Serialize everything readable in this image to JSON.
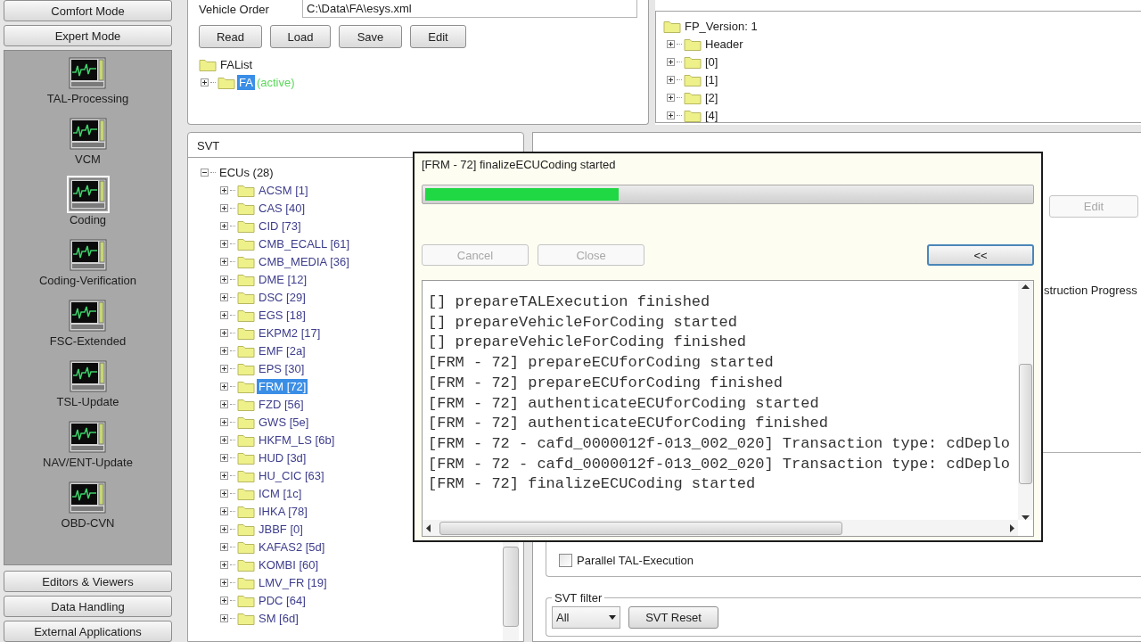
{
  "sidebar": {
    "top_buttons": [
      "Comfort Mode",
      "Expert Mode"
    ],
    "tools": [
      {
        "label": "TAL-Processing",
        "selected": false
      },
      {
        "label": "VCM",
        "selected": false
      },
      {
        "label": "Coding",
        "selected": true
      },
      {
        "label": "Coding-Verification",
        "selected": false
      },
      {
        "label": "FSC-Extended",
        "selected": false
      },
      {
        "label": "TSL-Update",
        "selected": false
      },
      {
        "label": "NAV/ENT-Update",
        "selected": false
      },
      {
        "label": "OBD-CVN",
        "selected": false
      }
    ],
    "bottom_buttons": [
      "Editors & Viewers",
      "Data Handling",
      "External Applications"
    ]
  },
  "vehicle_order": {
    "label": "Vehicle Order",
    "path": "C:\\Data\\FA\\esys.xml",
    "buttons": [
      "Read",
      "Load",
      "Save",
      "Edit"
    ],
    "tree": {
      "label": "FAList",
      "children": [
        {
          "label": "FA",
          "status": "(active)",
          "selected": true
        }
      ]
    }
  },
  "vehicle_profile": {
    "tree": {
      "label": "FP_Version: 1",
      "children": [
        {
          "label": "Header"
        },
        {
          "label": "[0]"
        },
        {
          "label": "[1]"
        },
        {
          "label": "[2]"
        },
        {
          "label": "[4]"
        }
      ]
    }
  },
  "svt": {
    "title": "SVT",
    "tree": {
      "label": "ECUs (28)",
      "expanded": true,
      "children": [
        {
          "label": "ACSM [1]",
          "selected": false
        },
        {
          "label": "CAS [40]",
          "selected": false
        },
        {
          "label": "CID [73]",
          "selected": false
        },
        {
          "label": "CMB_ECALL [61]",
          "selected": false
        },
        {
          "label": "CMB_MEDIA [36]",
          "selected": false
        },
        {
          "label": "DME [12]",
          "selected": false
        },
        {
          "label": "DSC [29]",
          "selected": false
        },
        {
          "label": "EGS [18]",
          "selected": false
        },
        {
          "label": "EKPM2 [17]",
          "selected": false
        },
        {
          "label": "EMF [2a]",
          "selected": false
        },
        {
          "label": "EPS [30]",
          "selected": false
        },
        {
          "label": "FRM [72]",
          "selected": true
        },
        {
          "label": "FZD [56]",
          "selected": false
        },
        {
          "label": "GWS [5e]",
          "selected": false
        },
        {
          "label": "HKFM_LS [6b]",
          "selected": false
        },
        {
          "label": "HUD [3d]",
          "selected": false
        },
        {
          "label": "HU_CIC [63]",
          "selected": false
        },
        {
          "label": "ICM [1c]",
          "selected": false
        },
        {
          "label": "IHKA [78]",
          "selected": false
        },
        {
          "label": "JBBF [0]",
          "selected": false
        },
        {
          "label": "KAFAS2 [5d]",
          "selected": false
        },
        {
          "label": "KOMBI [60]",
          "selected": false
        },
        {
          "label": "LMV_FR [19]",
          "selected": false
        },
        {
          "label": "PDC [64]",
          "selected": false
        },
        {
          "label": "SM [6d]",
          "selected": false
        }
      ]
    }
  },
  "svt_actual": {
    "edit_button": {
      "label": "Edit",
      "disabled": true
    },
    "progress_label": "struction Progress",
    "parallel": {
      "label": "Parallel TAL-Execution",
      "checked": false
    },
    "filter": {
      "title": "SVT filter",
      "value": "All",
      "reset": "SVT Reset"
    }
  },
  "dialog": {
    "status": "[FRM - 72] finalizeECUCoding started",
    "level": 0.32,
    "buttons": [
      {
        "label": "Cancel",
        "disabled": true
      },
      {
        "label": "Close",
        "disabled": true
      }
    ],
    "toggle": "<<",
    "log": [
      "[] prepareTALExecution finished",
      "[] prepareVehicleForCoding started",
      "[] prepareVehicleForCoding finished",
      "[FRM - 72] prepareECUforCoding started",
      "[FRM - 72] prepareECUforCoding finished",
      "[FRM - 72] authenticateECUforCoding started",
      "[FRM - 72] authenticateECUforCoding finished",
      "[FRM - 72 - cafd_0000012f-013_002_020] Transaction type: cdDeplo",
      "[FRM - 72 - cafd_0000012f-013_002_020] Transaction type: cdDeplo",
      "[FRM - 72] finalizeECUCoding started"
    ]
  }
}
